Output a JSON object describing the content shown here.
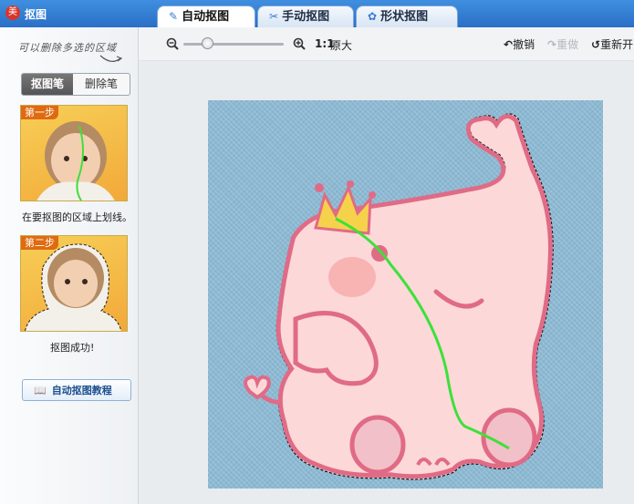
{
  "app": {
    "title": "抠图",
    "icon": "app-logo-icon",
    "icon_glyph": "美"
  },
  "tabs": [
    {
      "label": "自动抠图",
      "icon": "brush-icon",
      "active": true
    },
    {
      "label": "手动抠图",
      "icon": "hand-cut-icon",
      "active": false
    },
    {
      "label": "形状抠图",
      "icon": "shape-icon",
      "active": false
    }
  ],
  "left_panel": {
    "hint": "可以删除多选的区域",
    "mode": {
      "cutout_label": "抠图笔",
      "erase_label": "删除笔",
      "selected": "抠图笔"
    },
    "step1": {
      "badge": "第一步",
      "caption": "在要抠图的区域上划线。"
    },
    "step2": {
      "badge": "第二步",
      "caption": "抠图成功!"
    },
    "tutorial_label": "自动抠图教程"
  },
  "toolbar": {
    "zoom_out_icon": "zoom-out-icon",
    "zoom_in_icon": "zoom-in-icon",
    "zoom_level": 0.2,
    "ratio_label": "1:1",
    "original_size": "原大",
    "undo": "撤销",
    "redo": "重做",
    "reset": "重新开"
  },
  "colors": {
    "accent": "#2a6fc6",
    "canvas_bg": "#8db9d2",
    "elephant": "#fcd8d8",
    "outline": "#e06b86",
    "stroke": "#3ee03a"
  }
}
